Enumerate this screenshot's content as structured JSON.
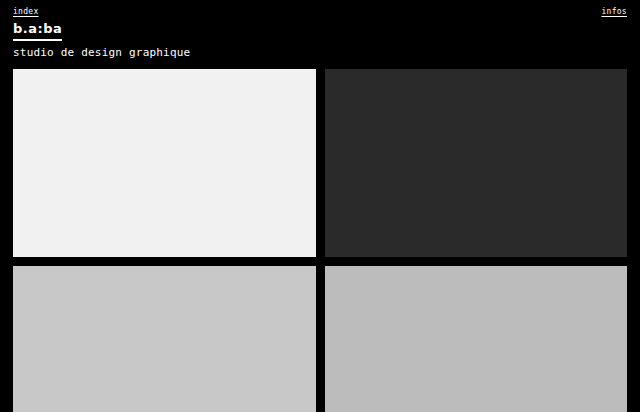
{
  "nav": {
    "left": "index",
    "right": "infos"
  },
  "brand": {
    "logo": "b.a:ba",
    "tagline": "studio de design graphique"
  },
  "projects": [
    {
      "color": "#f1f1f1"
    },
    {
      "color": "#2a2a2a"
    },
    {
      "color": "#c8c8c8"
    },
    {
      "color": "#bcbcbc"
    }
  ]
}
